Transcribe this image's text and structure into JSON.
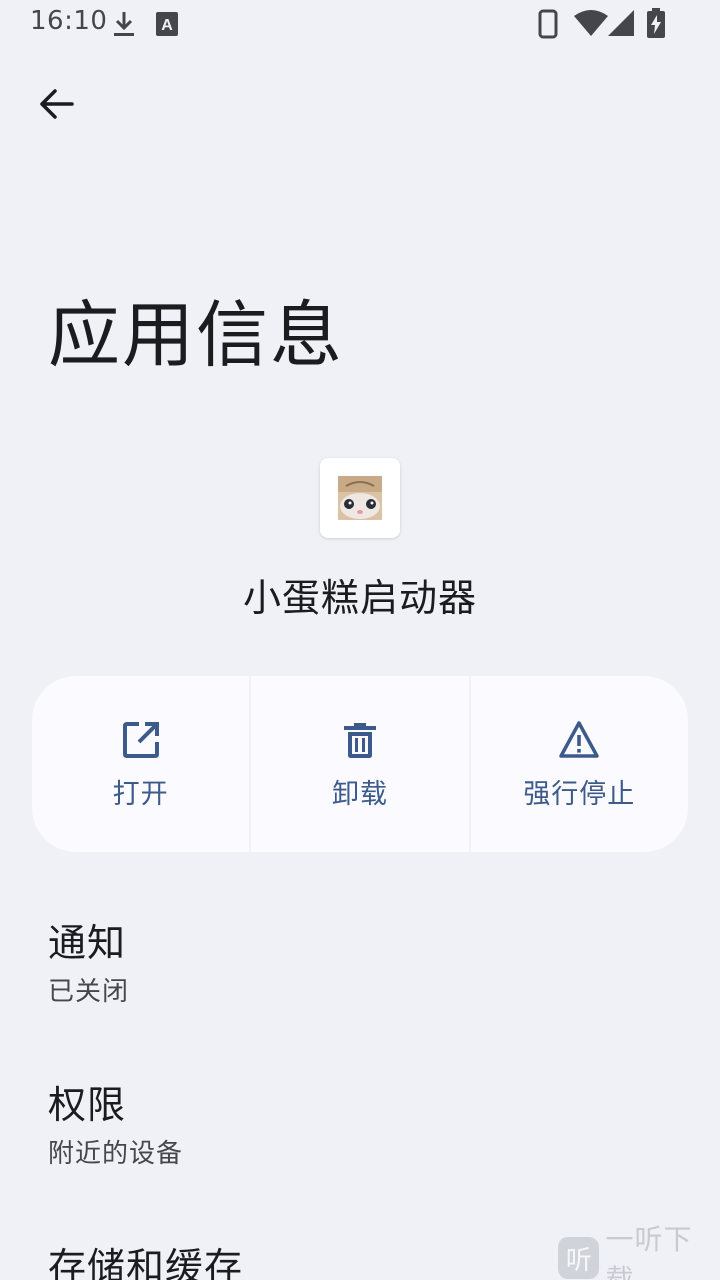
{
  "status_bar": {
    "time": "16:10",
    "icons": [
      "download-icon",
      "font-a-icon",
      "phone-icon",
      "wifi-icon",
      "cell-signal-icon",
      "battery-charging-icon"
    ]
  },
  "header": {
    "back_icon": "arrow-back-icon",
    "title": "应用信息"
  },
  "app": {
    "name": "小蛋糕启动器",
    "icon": "app-icon-cat-photo"
  },
  "actions": [
    {
      "label": "打开",
      "icon": "open-external-icon"
    },
    {
      "label": "卸载",
      "icon": "trash-icon"
    },
    {
      "label": "强行停止",
      "icon": "warning-icon"
    }
  ],
  "preferences": [
    {
      "title": "通知",
      "summary": "已关闭"
    },
    {
      "title": "权限",
      "summary": "附近的设备"
    },
    {
      "title": "存储和缓存",
      "summary": ""
    }
  ],
  "watermark": {
    "badge": "听",
    "text": "一听下载"
  },
  "colors": {
    "background": "#f0f1f7",
    "accent": "#3c5a8a",
    "surface": "#fbfbff"
  }
}
